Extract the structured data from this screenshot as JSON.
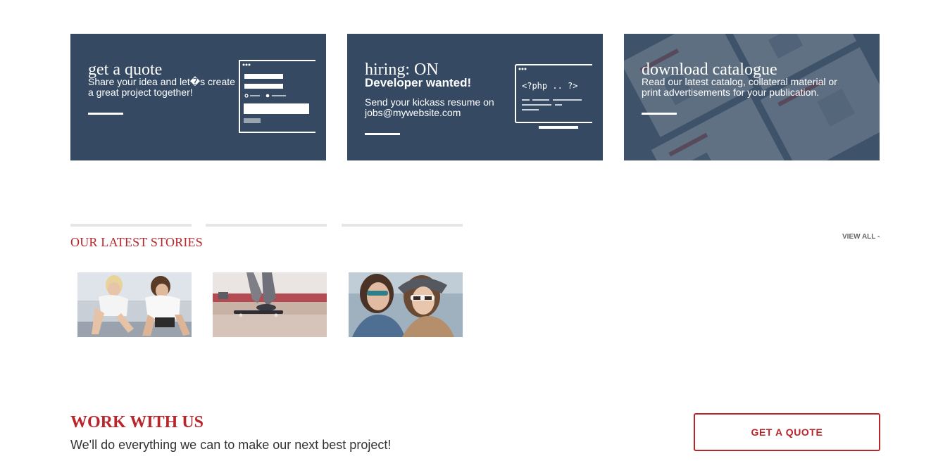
{
  "cards": [
    {
      "title": "get a quote",
      "description": "Share your idea and let�s create a great project together!",
      "illustration_icon": "form-window-icon"
    },
    {
      "title": "hiring: ON",
      "subtitle": "Developer wanted!",
      "description": "Send your kickass resume on jobs@mywebsite.com",
      "illustration_icon": "code-window-icon",
      "code_snippet": "<?php .. ?>"
    },
    {
      "title": "download catalogue",
      "description": "Read our latest catalog, collateral material or print advertisements for your publication."
    }
  ],
  "stories": {
    "heading": "OUR LATEST STORIES",
    "view_all": "VIEW ALL -",
    "items": [
      {
        "image": "women-stretching-photo"
      },
      {
        "image": "skateboarder-legs-photo"
      },
      {
        "image": "two-women-sunglasses-photo"
      }
    ]
  },
  "cta": {
    "title": "WORK WITH US",
    "subtitle": "We'll do everything we can to make our next best project!",
    "button_label": "GET A QUOTE"
  },
  "colors": {
    "card_bg": "#354a62",
    "accent": "#b8252a",
    "tab_bar": "#e6e6e6"
  }
}
